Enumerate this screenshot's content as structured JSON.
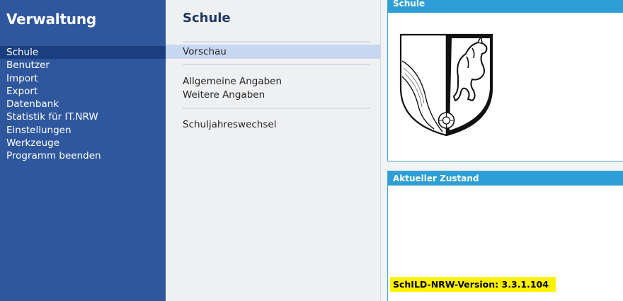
{
  "nav": {
    "title": "Verwaltung",
    "items": [
      {
        "label": "Schule",
        "active": true
      },
      {
        "label": "Benutzer"
      },
      {
        "label": "Import"
      },
      {
        "label": "Export"
      },
      {
        "label": "Datenbank"
      },
      {
        "label": "Statistik für IT.NRW"
      },
      {
        "label": "Einstellungen"
      },
      {
        "label": "Werkzeuge"
      },
      {
        "label": "Programm beenden"
      }
    ]
  },
  "main": {
    "title": "Schule",
    "items": [
      {
        "label": "Vorschau",
        "selected": true
      },
      {
        "label": "Allgemeine Angaben"
      },
      {
        "label": "Weitere Angaben"
      },
      {
        "label": "Schuljahreswechsel"
      }
    ]
  },
  "panels": {
    "school": {
      "header": "Schule",
      "crest_icon": "nrw-coat-of-arms-icon"
    },
    "state": {
      "header": "Aktueller Zustand",
      "version": "SchILD-NRW-Version: 3.3.1.104"
    }
  },
  "colors": {
    "nav_bg": "#2f579e",
    "nav_active": "#1b3f7e",
    "selection": "#c8d7f0",
    "panel_header": "#2e9fd6",
    "highlight": "#fff200"
  }
}
